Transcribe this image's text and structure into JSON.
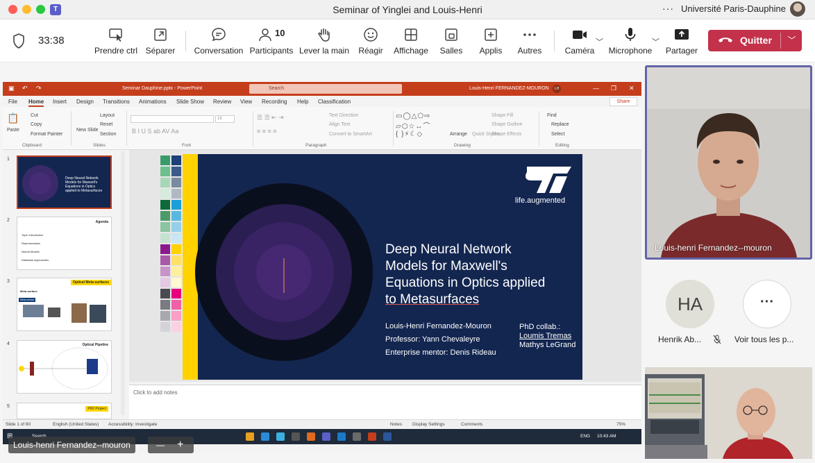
{
  "window": {
    "title": "Seminar of Yinglei and Louis-Henri",
    "org": "Université Paris-Dauphine",
    "more": "···"
  },
  "toolbar": {
    "timer": "33:38",
    "buttons": [
      {
        "label": "Prendre ctrl",
        "icon": "take-control-icon"
      },
      {
        "label": "Séparer",
        "icon": "pop-out-icon"
      },
      {
        "label": "Conversation",
        "icon": "chat-icon"
      },
      {
        "label": "Participants",
        "icon": "people-icon",
        "count": "10"
      },
      {
        "label": "Lever la main",
        "icon": "raise-hand-icon"
      },
      {
        "label": "Réagir",
        "icon": "smiley-icon"
      },
      {
        "label": "Affichage",
        "icon": "grid-icon"
      },
      {
        "label": "Salles",
        "icon": "breakout-rooms-icon"
      },
      {
        "label": "Applis",
        "icon": "add-apps-icon"
      },
      {
        "label": "Autres",
        "icon": "more-icon"
      },
      {
        "label": "Caméra",
        "icon": "camera-icon"
      },
      {
        "label": "Microphone",
        "icon": "microphone-icon"
      },
      {
        "label": "Partager",
        "icon": "share-icon"
      }
    ],
    "quit_label": "Quitter",
    "accent": "#c4314b"
  },
  "powerpoint": {
    "title": "Seminar Dauphine.pptx  -  PowerPoint",
    "search": "Search",
    "user": "Louis-Henri FERNANDEZ-MOURON",
    "user_initials": "LH",
    "share": "Share",
    "menu": [
      "File",
      "Home",
      "Insert",
      "Design",
      "Transitions",
      "Animations",
      "Slide Show",
      "Review",
      "View",
      "Recording",
      "Help",
      "Classification"
    ],
    "ribbon": {
      "paste": "Paste",
      "cut": "Cut",
      "copy": "Copy",
      "format_painter": "Format Painter",
      "new_slide": "New Slide",
      "layout": "Layout",
      "reset": "Reset",
      "section": "Section",
      "font_size": "18",
      "text_direction": "Text Direction",
      "align_text": "Align Text",
      "smartart": "Convert to SmartArt",
      "arrange": "Arrange",
      "quick_styles": "Quick Styles",
      "shape_fill": "Shape Fill",
      "shape_outline": "Shape Outline",
      "shape_effects": "Shape Effects",
      "find": "Find",
      "replace": "Replace",
      "select": "Select",
      "groups": [
        "Clipboard",
        "Slides",
        "Font",
        "Paragraph",
        "Drawing",
        "Editing"
      ]
    },
    "thumbnails": [
      {
        "num": "1",
        "title": "Deep Neural Network Models for Maxwell's Equations in Optics applied to Metasurfaces"
      },
      {
        "num": "2",
        "title": "Agenda",
        "items": [
          "Topic Introduction",
          "Representation",
          "Neural Models",
          "Database approaches"
        ]
      },
      {
        "num": "3",
        "title": "Optical Meta-surfaces",
        "subtitle": "Meta-surface",
        "tag": "Meta-surface"
      },
      {
        "num": "4",
        "title": "Optical Pipeline"
      },
      {
        "num": "5",
        "title": "PhD Project"
      }
    ],
    "slide": {
      "brand": "life.augmented",
      "title_lines": [
        "Deep Neural Network",
        "Models for Maxwell's",
        "Equations in Optics applied",
        "to Metasurfaces"
      ],
      "author": "Louis-Henri Fernandez-Mouron",
      "professor": "Professor: Yann Chevaleyre",
      "mentor": "Enterprise mentor: Denis Rideau",
      "collab_title": "PhD collab.:",
      "collab_1": "Loumis Tremas",
      "collab_2": "Mathys LeGrand"
    },
    "notes_placeholder": "Click to add notes",
    "status": {
      "slide_count": "Slide 1 of 60",
      "language": "English (United States)",
      "accessibility": "Accessibility: Investigate",
      "notes": "Notes",
      "display_settings": "Display Settings",
      "comments": "Comments",
      "zoom": "75%"
    },
    "taskbar": {
      "search": "Search",
      "lang": "ENG",
      "time": "10:43 AM"
    }
  },
  "presenter": {
    "name": "Louis-henri Fernandez--mouron",
    "zoom_out": "—",
    "zoom_in": "+"
  },
  "participants": {
    "main_name": "Louis-henri Fernandez--mouron",
    "ha_initials": "HA",
    "ha_name": "Henrik Ab...",
    "more_label": "Voir tous les p...",
    "more_glyph": "···"
  }
}
